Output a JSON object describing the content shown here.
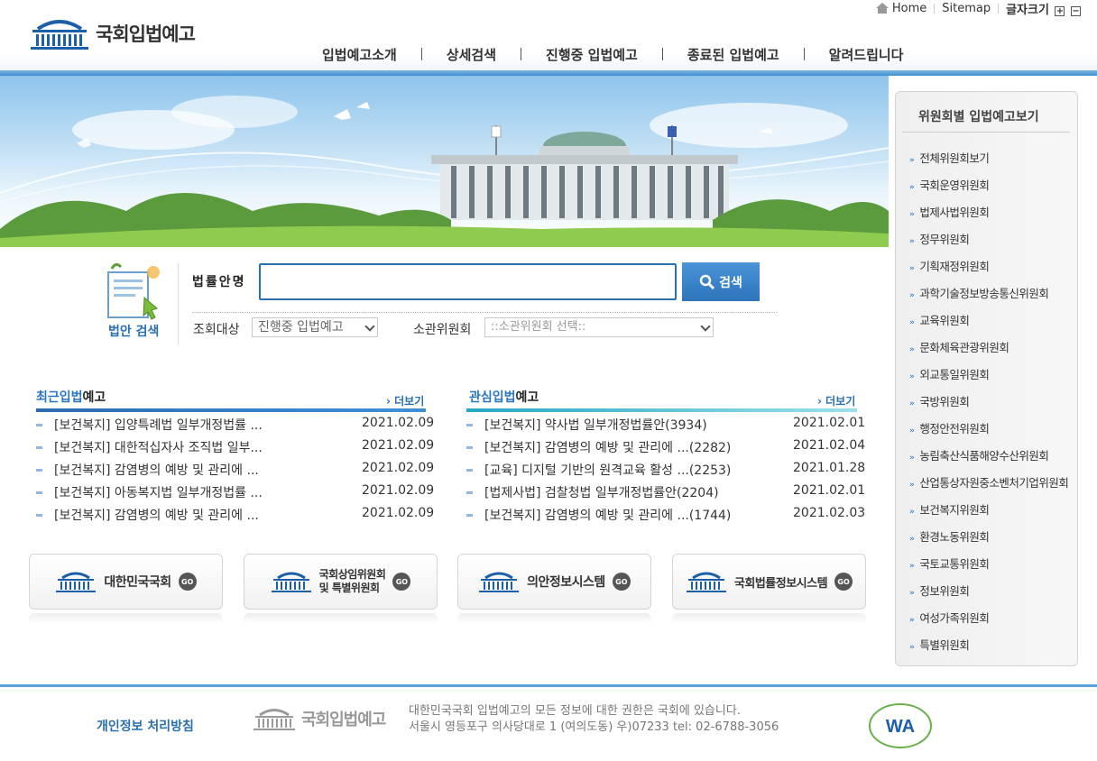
{
  "header": {
    "logo_text": "국회입법예고",
    "utility": {
      "home": "Home",
      "sitemap": "Sitemap",
      "font_size": "글자크기",
      "plus": "+",
      "minus": "−"
    },
    "nav": [
      "입법예고소개",
      "상세검색",
      "진행중 입법예고",
      "종료된 입법예고",
      "알려드립니다"
    ]
  },
  "search": {
    "icon_label": "법안 검색",
    "label": "법률안명",
    "input_value": "",
    "button": "검색",
    "target_label": "조회대상",
    "target_value": "진행중 입법예고",
    "committee_label": "소관위원회",
    "committee_value": "::소관위원회 선택::"
  },
  "recent": {
    "title_blue": "최근입법",
    "title_rest": "예고",
    "more": "› 더보기",
    "items": [
      {
        "text": "[보건복지] 입양특례법 일부개정법률 ...",
        "date": "2021.02.09"
      },
      {
        "text": "[보건복지] 대한적십자사 조직법 일부...",
        "date": "2021.02.09"
      },
      {
        "text": "[보건복지] 감염병의 예방 및 관리에 ...",
        "date": "2021.02.09"
      },
      {
        "text": "[보건복지] 아동복지법 일부개정법률 ...",
        "date": "2021.02.09"
      },
      {
        "text": "[보건복지] 감염병의 예방 및 관리에 ...",
        "date": "2021.02.09"
      }
    ]
  },
  "interest": {
    "title_blue": "관심입법",
    "title_rest": "예고",
    "more": "› 더보기",
    "items": [
      {
        "text": "[보건복지] 약사법 일부개정법률안(3934)",
        "date": "2021.02.01"
      },
      {
        "text": "[보건복지] 감염병의 예방 및 관리에 ...(2282)",
        "date": "2021.02.04"
      },
      {
        "text": "[교육] 디지털 기반의 원격교육 활성 ...(2253)",
        "date": "2021.01.28"
      },
      {
        "text": "[법제사법] 검찰청법 일부개정법률안(2204)",
        "date": "2021.02.01"
      },
      {
        "text": "[보건복지] 감염병의 예방 및 관리에 ...(1744)",
        "date": "2021.02.03"
      }
    ]
  },
  "quick_links": [
    {
      "label": "대한민국국회",
      "go": "GO"
    },
    {
      "label": "국회상임위원회",
      "label2": "및 특별위원회",
      "go": "GO"
    },
    {
      "label": "의안정보시스템",
      "go": "GO"
    },
    {
      "label": "국회법률정보시스템",
      "go": "GO"
    }
  ],
  "sidebar": {
    "title": "위원회별 입법예고보기",
    "items": [
      "전체위원회보기",
      "국회운영위원회",
      "법제사법위원회",
      "정무위원회",
      "기획재정위원회",
      "과학기술정보방송통신위원회",
      "교육위원회",
      "문화체육관광위원회",
      "외교통일위원회",
      "국방위원회",
      "행정안전위원회",
      "농림축산식품해양수산위원회",
      "산업통상자원중소벤처기업위원회",
      "보건복지위원회",
      "환경노동위원회",
      "국토교통위원회",
      "정보위원회",
      "여성가족위원회",
      "특별위원회"
    ]
  },
  "footer": {
    "privacy": "개인정보 처리방침",
    "logo_text": "국회입법예고",
    "line1": "대한민국국회 입법예고의 모든 정보에 대한 권한은 국회에 있습니다.",
    "line2": "서울시 영등포구 의사당대로 1 (여의도동) 우)07233 tel: 02-6788-3056",
    "wa_badge": "WA"
  },
  "colors": {
    "accent": "#2a6faf",
    "nav_line": "#3d8fd0",
    "cyan": "#25a7c7"
  }
}
